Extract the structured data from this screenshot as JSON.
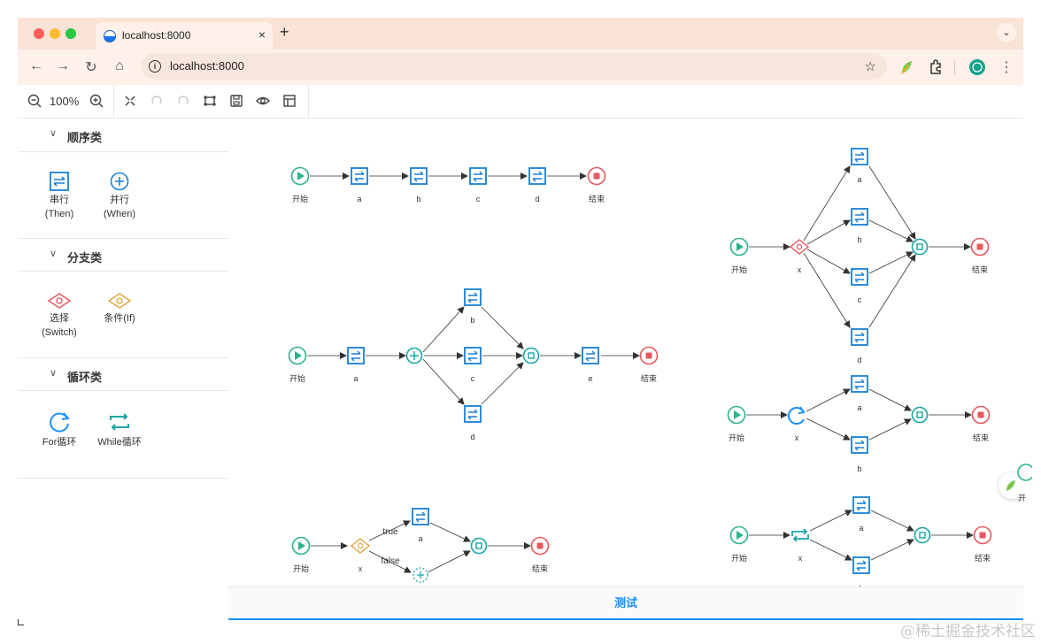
{
  "browser": {
    "tab_title": "localhost:8000",
    "tab_close": "×",
    "new_tab": "+",
    "url": "localhost:8000"
  },
  "toolbar": {
    "zoom": "100%"
  },
  "sidebar": {
    "groups": [
      {
        "title": "顺序类",
        "items": [
          {
            "label": "串行",
            "sub": "(Then)"
          },
          {
            "label": "并行",
            "sub": "(When)"
          }
        ]
      },
      {
        "title": "分支类",
        "items": [
          {
            "label": "选择",
            "sub": "(Switch)"
          },
          {
            "label": "条件(If)",
            "sub": ""
          }
        ]
      },
      {
        "title": "循环类",
        "items": [
          {
            "label": "For循环",
            "sub": ""
          },
          {
            "label": "While循环",
            "sub": ""
          }
        ]
      }
    ]
  },
  "labels": {
    "start": "开始",
    "end": "结束",
    "a": "a",
    "b": "b",
    "c": "c",
    "d": "d",
    "e": "e",
    "x": "x",
    "true": "true",
    "false": "false",
    "partial": "开"
  },
  "test_button": "测试",
  "watermark": "@稀土掘金技术社区",
  "colors": {
    "start": "#2bb38c",
    "end": "#e8575d",
    "then": "#1a7fd4",
    "parallel": "#1aa6a6",
    "switch": "#e8575d",
    "if": "#e3a23b",
    "loop": "#1890ff",
    "accent": "#1890ff"
  }
}
